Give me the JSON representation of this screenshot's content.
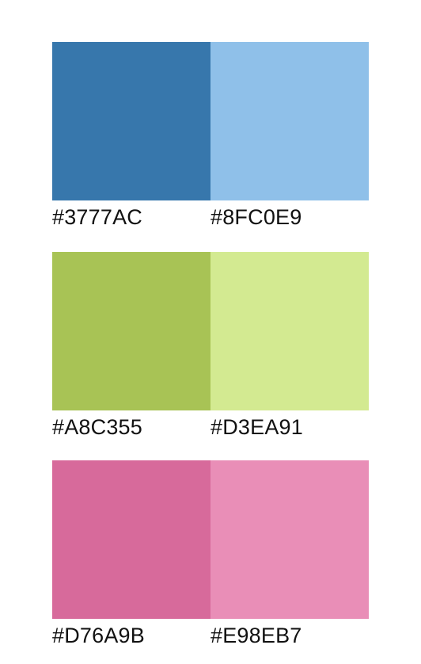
{
  "palettes": [
    {
      "left": {
        "color": "#3777AC",
        "label": "#3777AC"
      },
      "right": {
        "color": "#8FC0E9",
        "label": "#8FC0E9"
      }
    },
    {
      "left": {
        "color": "#A8C355",
        "label": "#A8C355"
      },
      "right": {
        "color": "#D3EA91",
        "label": "#D3EA91"
      }
    },
    {
      "left": {
        "color": "#D76A9B",
        "label": "#D76A9B"
      },
      "right": {
        "color": "#E98EB7",
        "label": "#E98EB7"
      }
    }
  ]
}
